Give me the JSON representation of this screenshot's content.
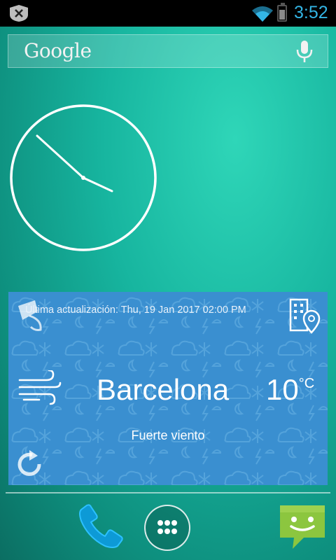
{
  "status_bar": {
    "time": "3:52",
    "icons": [
      "notification-x-icon",
      "wifi-icon",
      "battery-icon"
    ]
  },
  "search_bar": {
    "logo_text": "Google",
    "icon": "microphone-icon"
  },
  "clock_widget": {
    "type": "analog",
    "hour_hand": "3:52",
    "icon": "analog-clock"
  },
  "weather_widget": {
    "last_updated": "Última actualización: Thu, 19 Jan 2017 02:00 PM",
    "city": "Barcelona",
    "temperature": "10",
    "unit": "°C",
    "condition": "Fuerte viento",
    "icons": [
      "update-bucket-icon",
      "location-building-icon",
      "wind-icon",
      "refresh-icon"
    ],
    "background_color": "#3a8fd0"
  },
  "dock": {
    "items": [
      "phone-icon",
      "app-drawer-icon",
      "messaging-icon"
    ]
  },
  "colors": {
    "accent_time": "#33b5e5",
    "wallpaper": "#17b59f"
  }
}
